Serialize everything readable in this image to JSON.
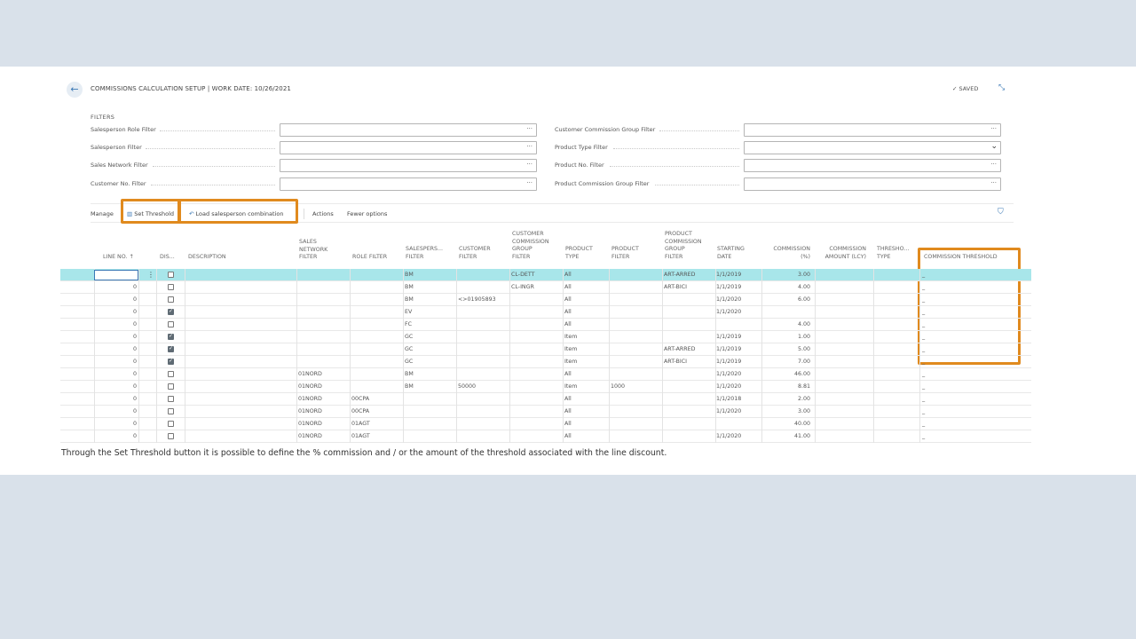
{
  "header": {
    "title": "COMMISSIONS CALCULATION SETUP | WORK DATE: 10/26/2021",
    "saved_label": "SAVED"
  },
  "filters": {
    "heading": "FILTERS",
    "left": [
      {
        "label": "Salesperson Role Filter"
      },
      {
        "label": "Salesperson Filter"
      },
      {
        "label": "Sales Network Filter"
      },
      {
        "label": "Customer No. Filter"
      }
    ],
    "right": [
      {
        "label": "Customer Commission Group Filter"
      },
      {
        "label": "Product Type Filter"
      },
      {
        "label": "Product No. Filter"
      },
      {
        "label": "Product Commission Group Filter"
      }
    ]
  },
  "toolbar": {
    "manage": "Manage",
    "set_threshold": "Set Threshold",
    "load_combination": "Load salesperson combination",
    "actions": "Actions",
    "fewer_options": "Fewer options"
  },
  "table": {
    "headers": {
      "line_no": "LINE NO.",
      "dis": "DIS...",
      "description": "DESCRIPTION",
      "network_l1": "SALES",
      "network_l2": "NETWORK",
      "network_l3": "FILTER",
      "role": "ROLE FILTER",
      "salesperson_l1": "SALESPERS...",
      "salesperson_l2": "FILTER",
      "customer_l1": "CUSTOMER",
      "customer_l2": "FILTER",
      "ccg_l1": "CUSTOMER",
      "ccg_l2": "COMMISSION",
      "ccg_l3": "GROUP",
      "ccg_l4": "FILTER",
      "ptype_l1": "PRODUCT",
      "ptype_l2": "TYPE",
      "pfilter_l1": "PRODUCT",
      "pfilter_l2": "FILTER",
      "pcg_l1": "PRODUCT",
      "pcg_l2": "COMMISSION",
      "pcg_l3": "GROUP",
      "pcg_l4": "FILTER",
      "date_l1": "STARTING",
      "date_l2": "DATE",
      "comm_l1": "COMMISSION",
      "comm_l2": "(%)",
      "amt_l1": "COMMISSION",
      "amt_l2": "AMOUNT (LCY)",
      "ttype_l1": "THRESHO...",
      "ttype_l2": "TYPE",
      "threshold": "COMMISSION THRESHOLD"
    },
    "rows": [
      {
        "line": "",
        "checked": false,
        "net": "",
        "role": "",
        "sp": "BM",
        "cust": "",
        "ccg": "CL-DETT",
        "pt": "All",
        "pf": "",
        "pcg": "ART-ARRED",
        "date": "1/1/2019",
        "comm": "3.00",
        "th": "_"
      },
      {
        "line": "0",
        "checked": false,
        "net": "",
        "role": "",
        "sp": "BM",
        "cust": "",
        "ccg": "CL-INGR",
        "pt": "All",
        "pf": "",
        "pcg": "ART-BICI",
        "date": "1/1/2019",
        "comm": "4.00",
        "th": "_"
      },
      {
        "line": "0",
        "checked": false,
        "net": "",
        "role": "",
        "sp": "BM",
        "cust": "<>01905893",
        "ccg": "",
        "pt": "All",
        "pf": "",
        "pcg": "",
        "date": "1/1/2020",
        "comm": "6.00",
        "th": "_"
      },
      {
        "line": "0",
        "checked": true,
        "net": "",
        "role": "",
        "sp": "EV",
        "cust": "",
        "ccg": "",
        "pt": "All",
        "pf": "",
        "pcg": "",
        "date": "1/1/2020",
        "comm": "",
        "th": "_"
      },
      {
        "line": "0",
        "checked": false,
        "net": "",
        "role": "",
        "sp": "FC",
        "cust": "",
        "ccg": "",
        "pt": "All",
        "pf": "",
        "pcg": "",
        "date": "",
        "comm": "4.00",
        "th": "_"
      },
      {
        "line": "0",
        "checked": true,
        "net": "",
        "role": "",
        "sp": "GC",
        "cust": "",
        "ccg": "",
        "pt": "Item",
        "pf": "",
        "pcg": "",
        "date": "1/1/2019",
        "comm": "1.00",
        "th": "_"
      },
      {
        "line": "0",
        "checked": true,
        "net": "",
        "role": "",
        "sp": "GC",
        "cust": "",
        "ccg": "",
        "pt": "Item",
        "pf": "",
        "pcg": "ART-ARRED",
        "date": "1/1/2019",
        "comm": "5.00",
        "th": "_"
      },
      {
        "line": "0",
        "checked": true,
        "net": "",
        "role": "",
        "sp": "GC",
        "cust": "",
        "ccg": "",
        "pt": "Item",
        "pf": "",
        "pcg": "ART-BICI",
        "date": "1/1/2019",
        "comm": "7.00",
        "th": "_"
      },
      {
        "line": "0",
        "checked": false,
        "net": "01NORD",
        "role": "",
        "sp": "BM",
        "cust": "",
        "ccg": "",
        "pt": "All",
        "pf": "",
        "pcg": "",
        "date": "1/1/2020",
        "comm": "46.00",
        "th": "_"
      },
      {
        "line": "0",
        "checked": false,
        "net": "01NORD",
        "role": "",
        "sp": "BM",
        "cust": "50000",
        "ccg": "",
        "pt": "Item",
        "pf": "1000",
        "pcg": "",
        "date": "1/1/2020",
        "comm": "8.81",
        "th": "_"
      },
      {
        "line": "0",
        "checked": false,
        "net": "01NORD",
        "role": "00CPA",
        "sp": "",
        "cust": "",
        "ccg": "",
        "pt": "All",
        "pf": "",
        "pcg": "",
        "date": "1/1/2018",
        "comm": "2.00",
        "th": "_"
      },
      {
        "line": "0",
        "checked": false,
        "net": "01NORD",
        "role": "00CPA",
        "sp": "",
        "cust": "",
        "ccg": "",
        "pt": "All",
        "pf": "",
        "pcg": "",
        "date": "1/1/2020",
        "comm": "3.00",
        "th": "_"
      },
      {
        "line": "0",
        "checked": false,
        "net": "01NORD",
        "role": "01AGT",
        "sp": "",
        "cust": "",
        "ccg": "",
        "pt": "All",
        "pf": "",
        "pcg": "",
        "date": "",
        "comm": "40.00",
        "th": "_"
      },
      {
        "line": "0",
        "checked": false,
        "net": "01NORD",
        "role": "01AGT",
        "sp": "",
        "cust": "",
        "ccg": "",
        "pt": "All",
        "pf": "",
        "pcg": "",
        "date": "1/1/2020",
        "comm": "41.00",
        "th": "_"
      }
    ]
  },
  "caption": "Through the Set Threshold button it is possible to define the % commission and / or the amount of the threshold associated with the line discount.",
  "colors": {
    "accent": "#3a78b5",
    "highlight": "#e08a1e",
    "selected_row": "#a8e6ea",
    "background": "#d9e1ea"
  },
  "icons": {
    "back": "arrow-left-icon",
    "saved": "check-icon",
    "collapse": "collapse-icon",
    "filter": "funnel-icon",
    "set_threshold": "threshold-icon",
    "load": "undo-arrow-icon"
  }
}
